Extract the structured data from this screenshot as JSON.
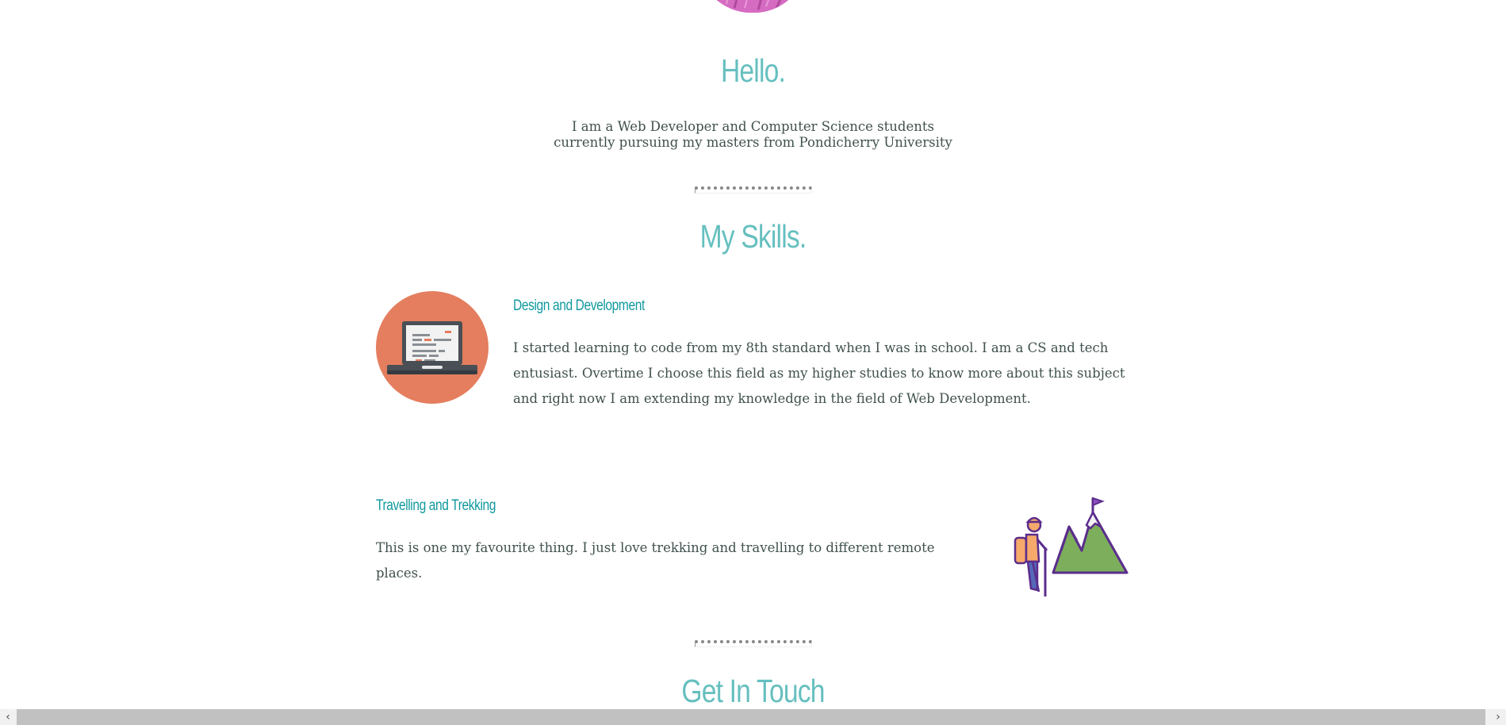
{
  "hello": {
    "title": "Hello.",
    "intro": "I am a Web Developer and Computer Science students currently pursuing my masters from Pondicherry University"
  },
  "skills": {
    "title": "My Skills.",
    "items": [
      {
        "heading": "Design and Development",
        "text": "I started learning to code from my 8th standard when I was in school. I am a CS and tech entusiast. Overtime I choose this field as my higher studies to know more about this subject and right now I am extending my knowledge in the field of Web Development.",
        "icon": "laptop-icon"
      },
      {
        "heading": "Travelling and Trekking",
        "text": "This is one my favourite thing. I just love trekking and travelling to different remote places.",
        "icon": "hiker-mountain-icon"
      }
    ]
  },
  "contact": {
    "title": "Get In Touch"
  },
  "scrollbar": {
    "left_arrow": "‹",
    "right_arrow": "›"
  },
  "colors": {
    "title": "#66bfbf",
    "heading": "#11999e",
    "text": "#40514e",
    "laptop_circle": "#e47e5f",
    "profile": "#d66bc2"
  }
}
